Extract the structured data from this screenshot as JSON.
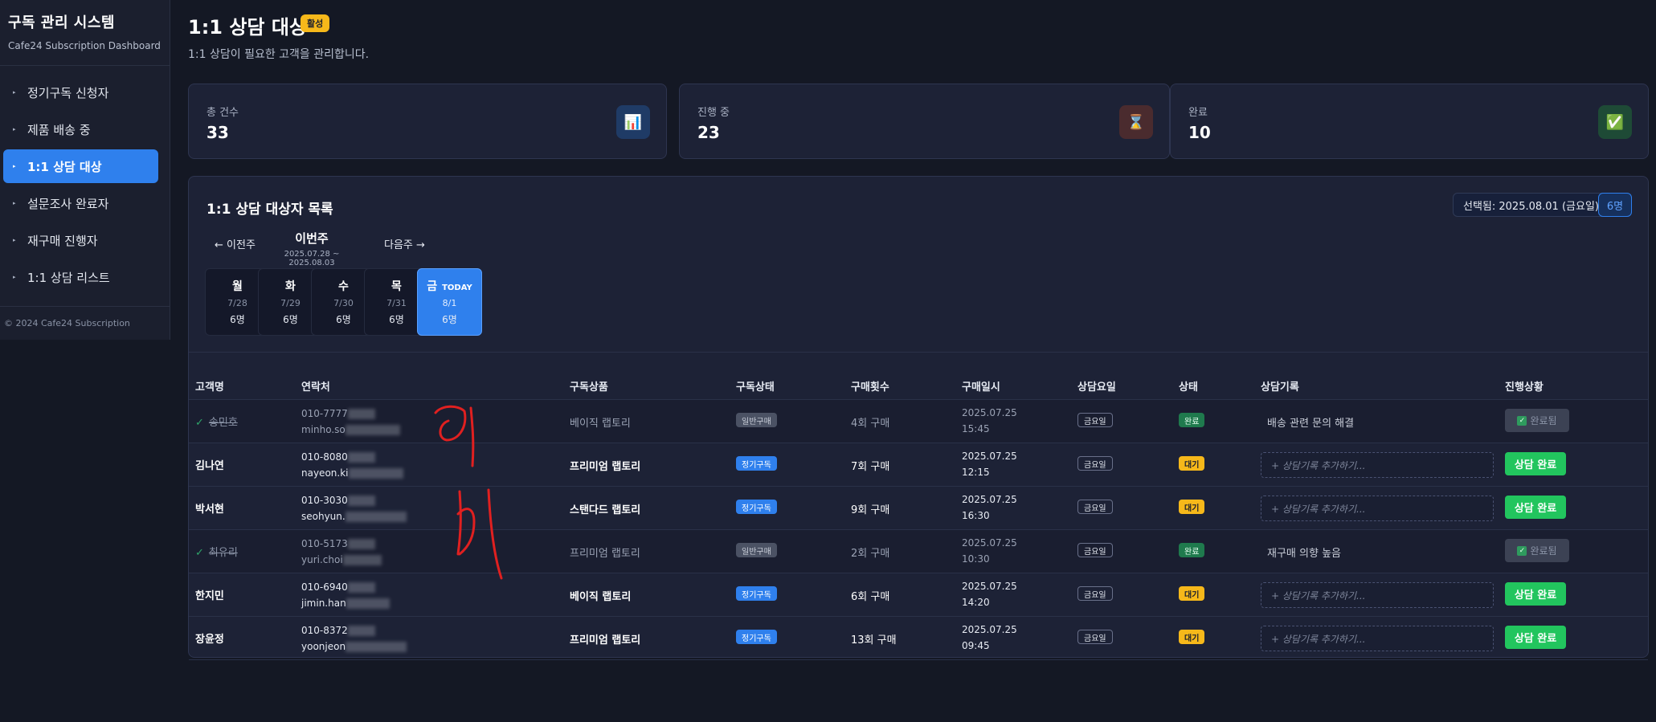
{
  "sidebar": {
    "title": "구독 관리 시스템",
    "subtitle": "Cafe24 Subscription Dashboard",
    "items": [
      {
        "label": "정기구독 신청자"
      },
      {
        "label": "제품 배송 중"
      },
      {
        "label": "1:1 상담 대상"
      },
      {
        "label": "설문조사 완료자"
      },
      {
        "label": "재구매 진행자"
      },
      {
        "label": "1:1 상담 리스트"
      }
    ],
    "active_index": 2,
    "copyright": "© 2024 Cafe24 Subscription"
  },
  "header": {
    "title": "1:1 상담 대상",
    "status": "활성",
    "subtitle": "1:1 상담이 필요한 고객을 관리합니다."
  },
  "stats": [
    {
      "label": "총 건수",
      "value": "33",
      "icon": "chart-icon",
      "glyph": "📊",
      "color": "#1f3b66"
    },
    {
      "label": "진행 중",
      "value": "23",
      "icon": "hourglass-icon",
      "glyph": "⌛",
      "color": "#4a2b2e"
    },
    {
      "label": "완료",
      "value": "10",
      "icon": "check-icon",
      "glyph": "✅",
      "color": "#1e4a36"
    }
  ],
  "list": {
    "title": "1:1 상담 대상자 목록",
    "selected": "선택됨: 2025.08.01 (금요일)",
    "selected_count": "6명",
    "week": {
      "prev": "← 이전주",
      "current": "이번주",
      "range": "2025.07.28 ~ 2025.08.03",
      "next": "다음주 →"
    },
    "days": [
      {
        "name": "월",
        "date": "7/28",
        "count": "6명"
      },
      {
        "name": "화",
        "date": "7/29",
        "count": "6명"
      },
      {
        "name": "수",
        "date": "7/30",
        "count": "6명"
      },
      {
        "name": "목",
        "date": "7/31",
        "count": "6명"
      },
      {
        "name": "금",
        "date": "8/1",
        "count": "6명",
        "today": "TODAY"
      }
    ],
    "columns": [
      "고객명",
      "연락처",
      "구독상품",
      "구독상태",
      "구매횟수",
      "구매일시",
      "상담요일",
      "상태",
      "상담기록",
      "진행상황"
    ],
    "record_placeholder": "+ 상담기록 추가하기...",
    "complete_button": "상담 완료",
    "done_button": "완료됨",
    "rows": [
      {
        "name": "송민호",
        "phone": "010-7777",
        "email": "minho.so",
        "product": "베이직 랩토리",
        "sub": "일반구매",
        "count": "4회 구매",
        "date": "2025.07.25",
        "time": "15:45",
        "day": "금요일",
        "status": "완료",
        "record": "배송 관련 문의 해결",
        "done": true
      },
      {
        "name": "김나연",
        "phone": "010-8080",
        "email": "nayeon.ki",
        "product": "프리미엄 랩토리",
        "sub": "정기구독",
        "count": "7회 구매",
        "date": "2025.07.25",
        "time": "12:15",
        "day": "금요일",
        "status": "대기",
        "record": "",
        "done": false
      },
      {
        "name": "박서현",
        "phone": "010-3030",
        "email": "seohyun.",
        "product": "스탠다드 랩토리",
        "sub": "정기구독",
        "count": "9회 구매",
        "date": "2025.07.25",
        "time": "16:30",
        "day": "금요일",
        "status": "대기",
        "record": "",
        "done": false
      },
      {
        "name": "최유리",
        "phone": "010-5173",
        "email": "yuri.choi",
        "product": "프리미엄 랩토리",
        "sub": "일반구매",
        "count": "2회 구매",
        "date": "2025.07.25",
        "time": "10:30",
        "day": "금요일",
        "status": "완료",
        "record": "재구매 의향 높음",
        "done": true
      },
      {
        "name": "한지민",
        "phone": "010-6940",
        "email": "jimin.han",
        "product": "베이직 랩토리",
        "sub": "정기구독",
        "count": "6회 구매",
        "date": "2025.07.25",
        "time": "14:20",
        "day": "금요일",
        "status": "대기",
        "record": "",
        "done": false
      },
      {
        "name": "장윤정",
        "phone": "010-8372",
        "email": "yoonjeon",
        "product": "프리미엄 랩토리",
        "sub": "정기구독",
        "count": "13회 구매",
        "date": "2025.07.25",
        "time": "09:45",
        "day": "금요일",
        "status": "대기",
        "record": "",
        "done": false
      }
    ]
  },
  "colors": {
    "accent": "#2f80ed",
    "success": "#22c55e",
    "warning": "#f6b81a",
    "annotation": "#e02020"
  }
}
